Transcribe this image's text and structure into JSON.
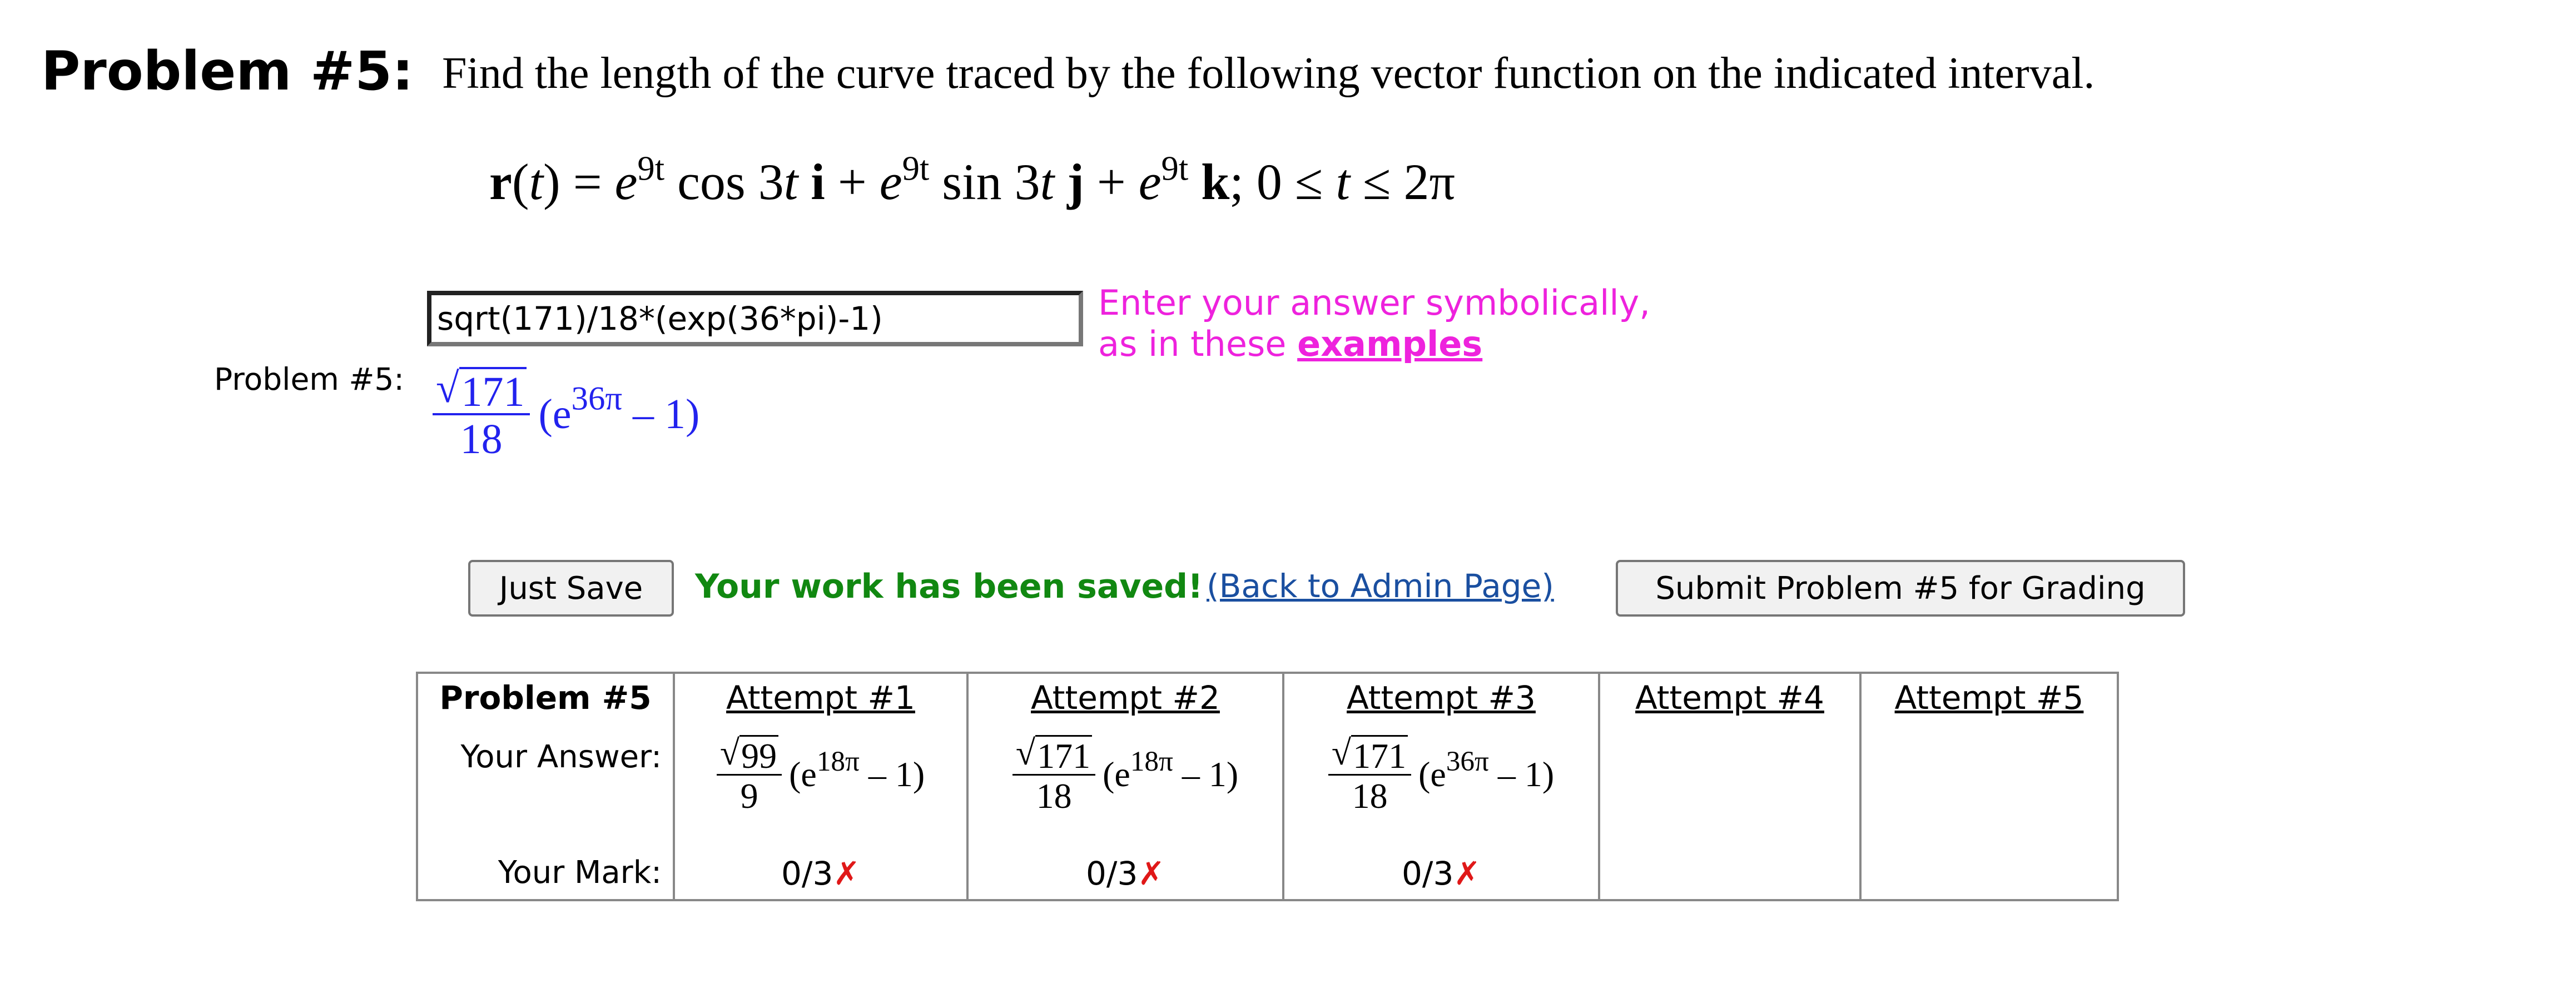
{
  "problem": {
    "label": "Problem #5:",
    "instruction": "Find the length of the curve traced by the following vector function on the indicated interval.",
    "equation": {
      "lhs_r": "r",
      "lhs_t": "(t)",
      "eq": "=",
      "e": "e",
      "exp": "9t",
      "cos": "cos 3",
      "t": "t",
      "i": "i",
      "plus": "+",
      "sin": "sin 3",
      "j": "j",
      "k": "k",
      "interval_start": "; 0 ≤ ",
      "interval_end": " ≤ 2π"
    }
  },
  "answer": {
    "side_label": "Problem #5:",
    "input_value": "sqrt(171)/18*(exp(36*pi)-1)",
    "hint_line1": "Enter your answer symbolically,",
    "hint_line2": "as in these ",
    "hint_link": "examples",
    "preview": {
      "radicand": "171",
      "denominator": "18",
      "open": "(e",
      "exponent": "36π",
      "close": " – 1)"
    }
  },
  "actions": {
    "save_label": "Just Save",
    "saved_message": "Your work has been saved!",
    "admin_link": "(Back to Admin Page)",
    "submit_label": "Submit Problem #5 for Grading"
  },
  "attempts": {
    "title": "Problem #5",
    "answer_label": "Your Answer:",
    "mark_label": "Your Mark:",
    "columns": [
      {
        "header": "Attempt #1",
        "radicand": "99",
        "denominator": "9",
        "open": "(e",
        "exponent": "18π",
        "close": " – 1)",
        "mark": "0/3",
        "cross": "✗"
      },
      {
        "header": "Attempt #2",
        "radicand": "171",
        "denominator": "18",
        "open": "(e",
        "exponent": "18π",
        "close": " – 1)",
        "mark": "0/3",
        "cross": "✗"
      },
      {
        "header": "Attempt #3",
        "radicand": "171",
        "denominator": "18",
        "open": "(e",
        "exponent": "36π",
        "close": " – 1)",
        "mark": "0/3",
        "cross": "✗"
      },
      {
        "header": "Attempt #4"
      },
      {
        "header": "Attempt #5"
      }
    ]
  },
  "colors": {
    "hint": "#ee22dd",
    "preview": "#2222ee",
    "saved": "#118811",
    "link": "#1a4fa0",
    "cross": "#e01818"
  }
}
